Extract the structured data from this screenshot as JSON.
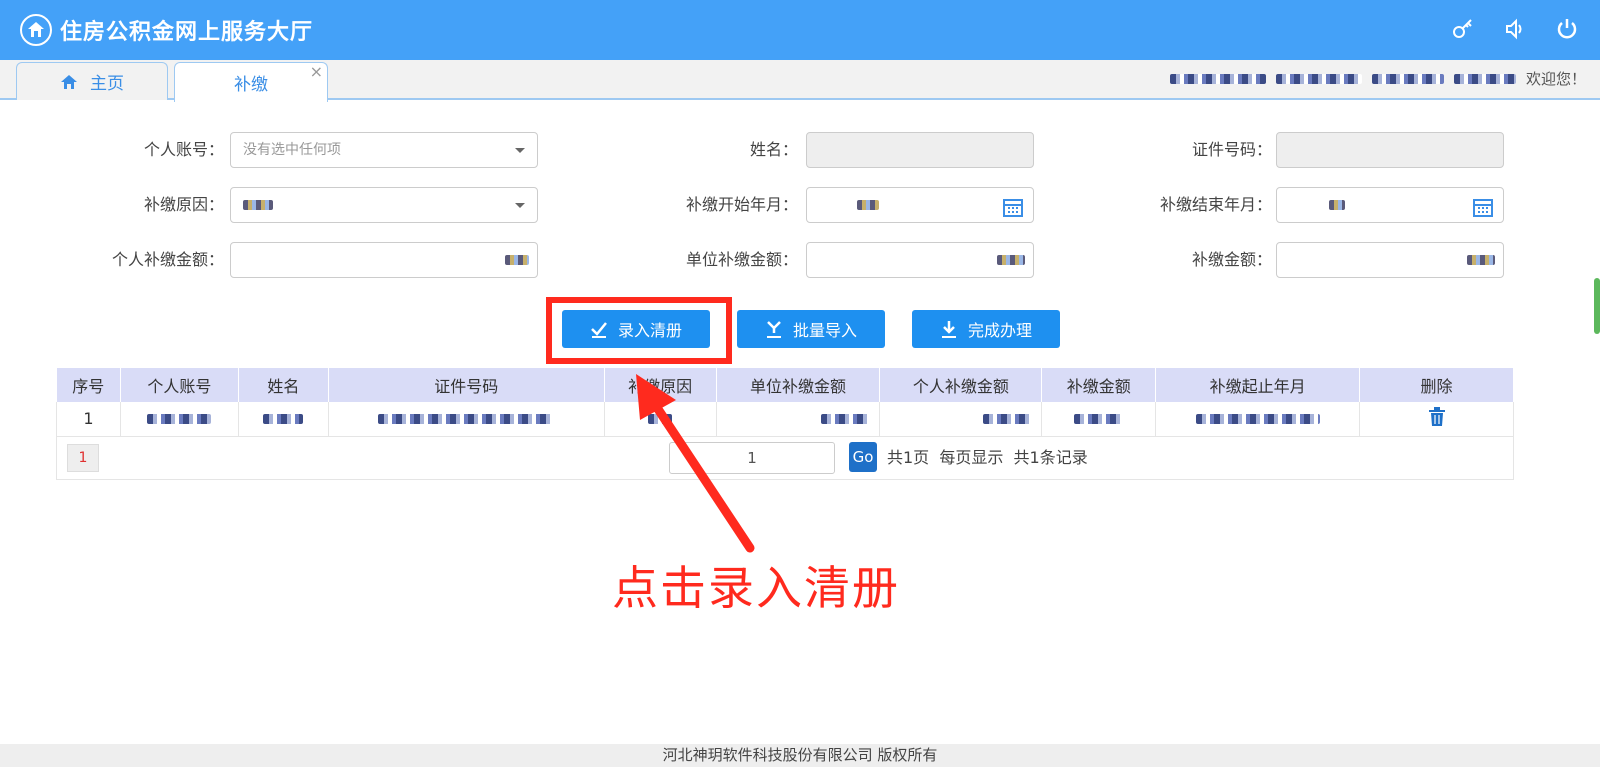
{
  "header": {
    "app_title": "住房公积金网上服务大厅"
  },
  "tabs": {
    "home_label": "主页",
    "active_label": "补缴",
    "close_glyph": "×"
  },
  "user": {
    "welcome": "欢迎您！"
  },
  "form": {
    "account_label": "个人账号：",
    "account_placeholder": "没有选中任何项",
    "name_label": "姓名：",
    "id_label": "证件号码：",
    "reason_label": "补缴原因：",
    "start_label": "补缴开始年月：",
    "end_label": "补缴结束年月：",
    "personal_amount_label": "个人补缴金额：",
    "unit_amount_label": "单位补缴金额：",
    "amount_label": "补缴金额："
  },
  "buttons": {
    "enter_list": "录入清册",
    "batch_import": "批量导入",
    "finish": "完成办理"
  },
  "table": {
    "columns": [
      "序号",
      "个人账号",
      "姓名",
      "证件号码",
      "补缴原因",
      "单位补缴金额",
      "个人补缴金额",
      "补缴金额",
      "补缴起止年月",
      "删除"
    ],
    "rows": [
      {
        "index": "1"
      }
    ]
  },
  "pager": {
    "current_page": "1",
    "page_input": "1",
    "go_label": "Go",
    "info": "共1页  每页显示  共1条记录"
  },
  "annotation": {
    "text": "点击录入清册"
  },
  "footer": {
    "copyright": "河北神玥软件科技股份有限公司 版权所有"
  },
  "colors": {
    "topbar": "#44a1f8",
    "button": "#1e90f0",
    "highlight": "#ff2a1e",
    "table_header": "#d9dcf7"
  }
}
